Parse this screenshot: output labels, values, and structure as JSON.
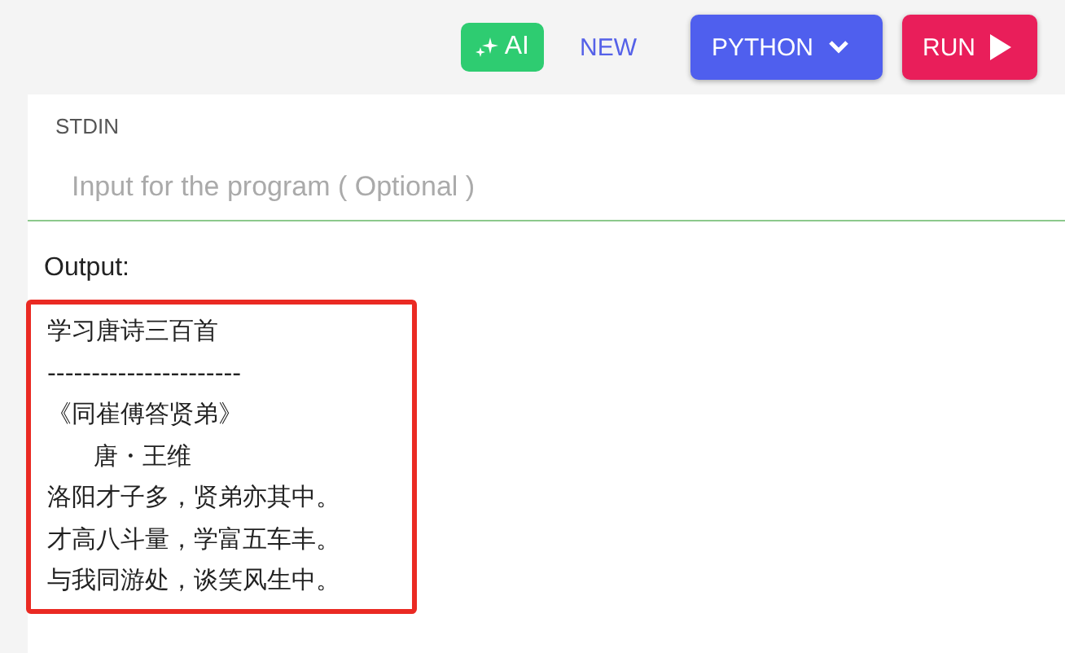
{
  "toolbar": {
    "ai_button": {
      "label": "AI"
    },
    "new_button": {
      "label": "NEW"
    },
    "language_button": {
      "label": "PYTHON"
    },
    "run_button": {
      "label": "RUN"
    }
  },
  "stdin": {
    "label": "STDIN",
    "placeholder": "Input for the program ( Optional )"
  },
  "output": {
    "label": "Output:",
    "highlighted": true,
    "lines": [
      "学习唐诗三百首",
      "----------------------",
      "《同崔傅答贤弟》",
      "      唐・王维",
      "洛阳才子多，贤弟亦其中。",
      "才高八斗量，学富五车丰。",
      "与我同游处，谈笑风生中。"
    ]
  }
}
